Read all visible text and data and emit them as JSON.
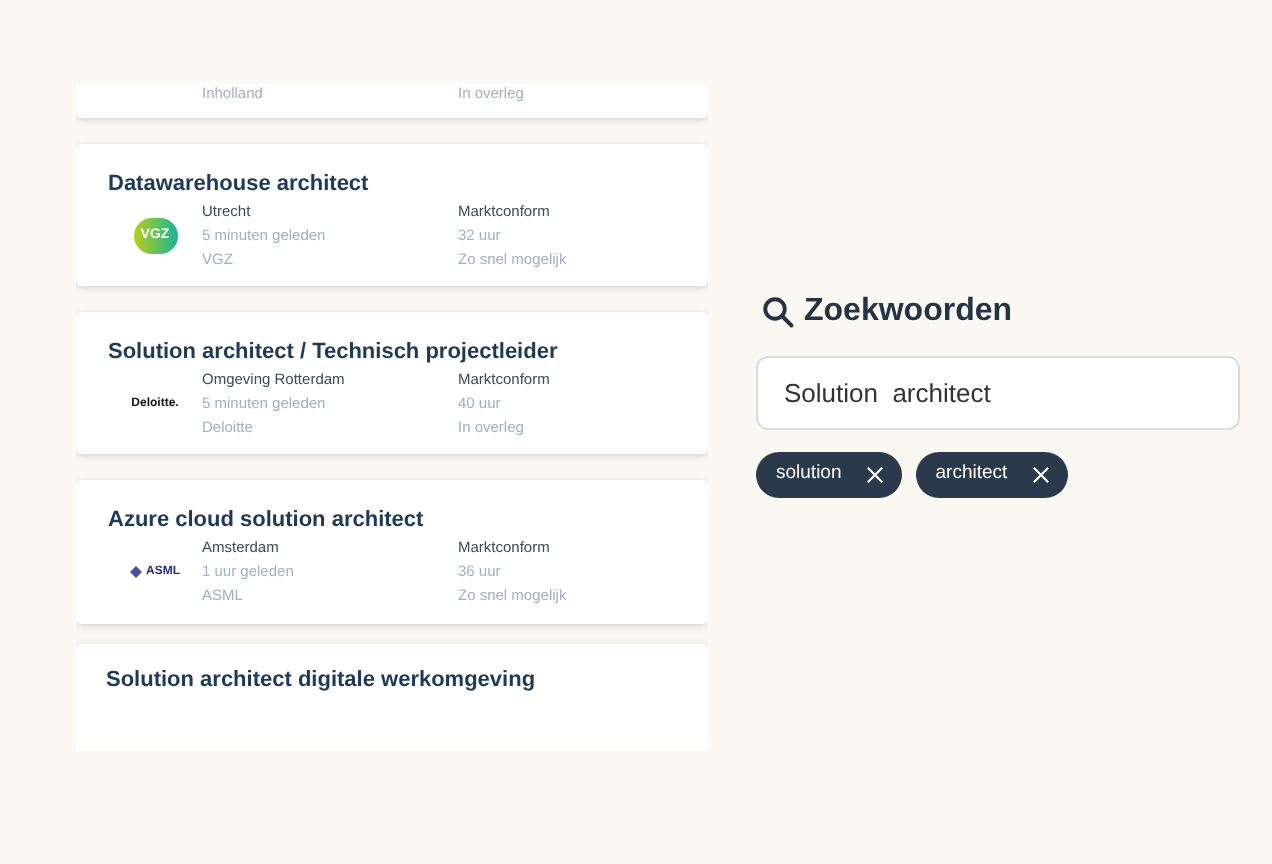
{
  "vacancies": [
    {
      "kind": "cut_top",
      "col1": "Inholland",
      "col2": "In overleg"
    },
    {
      "kind": "full",
      "title": "Datawarehouse architect",
      "logo": {
        "kind": "vgz",
        "text": "VGZ"
      },
      "col1": [
        "Utrecht",
        "5 minuten geleden",
        "VGZ"
      ],
      "col2": [
        "Marktconform",
        "32 uur",
        "Zo snel mogelijk"
      ]
    },
    {
      "kind": "full",
      "title": "Solution architect / Technisch projectleider",
      "logo": {
        "kind": "deloitte",
        "text": "Deloitte."
      },
      "col1": [
        "Omgeving Rotterdam",
        "5 minuten geleden",
        "Deloitte"
      ],
      "col2": [
        "Marktconform",
        "40 uur",
        "In overleg"
      ]
    },
    {
      "kind": "full",
      "title": "Azure cloud solution architect",
      "logo": {
        "kind": "asml",
        "text": "ASML"
      },
      "col1": [
        "Amsterdam",
        "1 uur geleden",
        "ASML"
      ],
      "col2": [
        "Marktconform",
        "36 uur",
        "Zo snel mogelijk"
      ]
    },
    {
      "kind": "cut_bottom",
      "title": "Solution architect digitale werkomgeving"
    }
  ],
  "keywords": {
    "heading": "Zoekwoorden",
    "value": "Solution  architect",
    "chips": [
      "solution",
      "architect"
    ]
  }
}
